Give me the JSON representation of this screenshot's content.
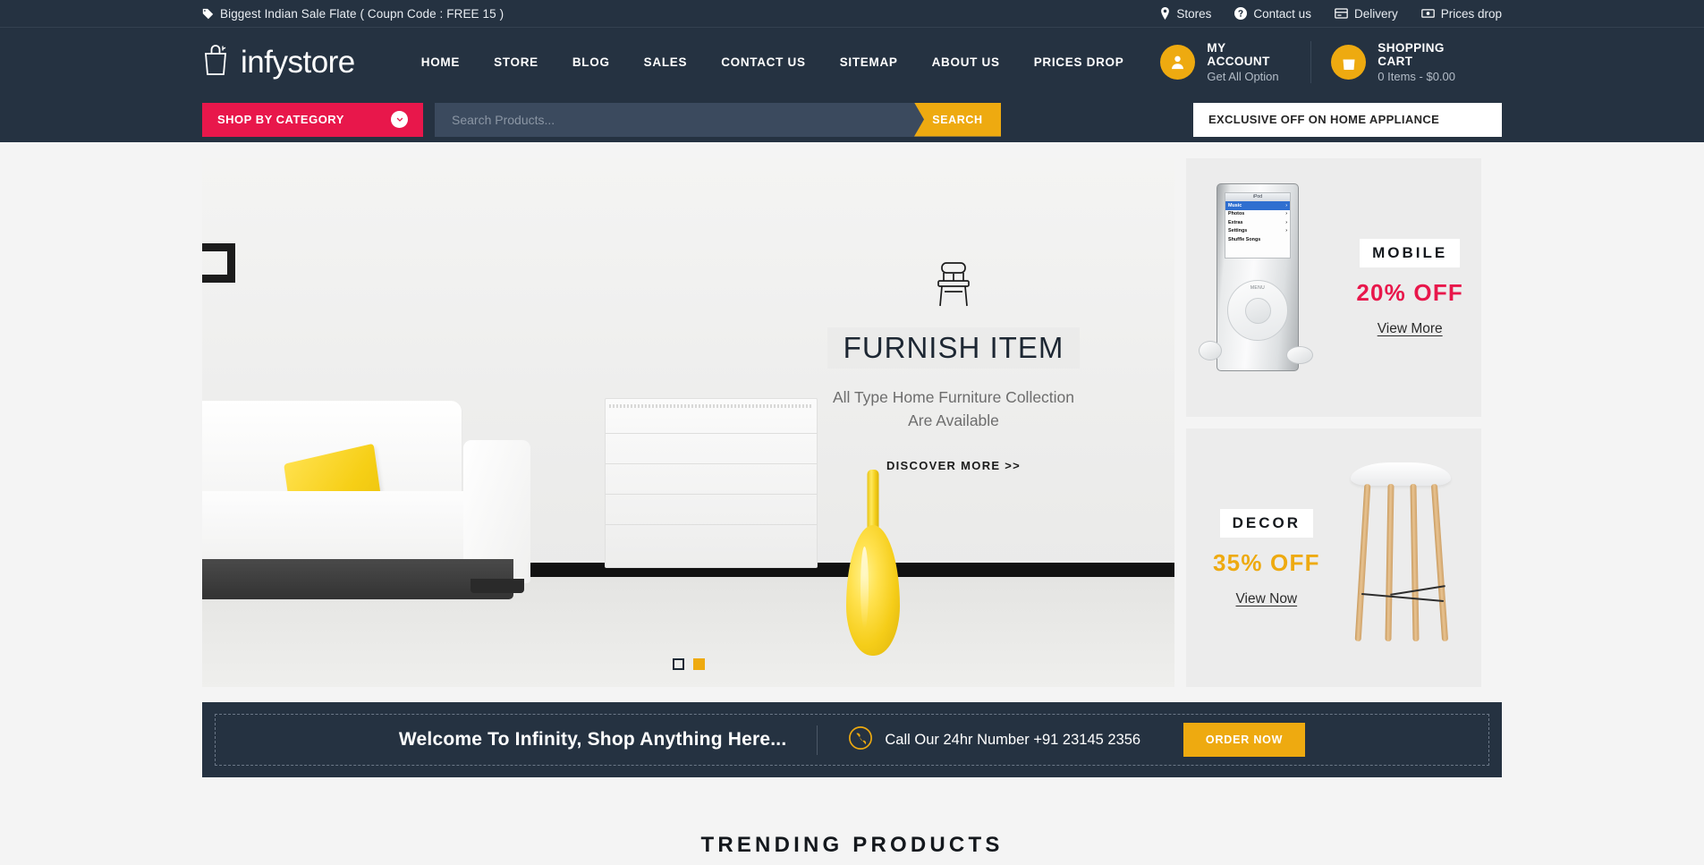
{
  "topbar": {
    "promo": "Biggest Indian Sale Flate ( Coupn Code : FREE 15 )",
    "promo_icon": "tag-icon",
    "links": [
      {
        "label": "Stores",
        "icon": "map-pin-icon"
      },
      {
        "label": "Contact us",
        "icon": "question-circle-icon"
      },
      {
        "label": "Delivery",
        "icon": "truck-card-icon"
      },
      {
        "label": "Prices drop",
        "icon": "price-tag-icon"
      }
    ]
  },
  "header": {
    "logo_text": "infystore",
    "logo_icon": "shopping-bag-icon",
    "nav": [
      {
        "label": "HOME"
      },
      {
        "label": "STORE"
      },
      {
        "label": "BLOG"
      },
      {
        "label": "SALES"
      },
      {
        "label": "CONTACT US"
      },
      {
        "label": "SITEMAP"
      },
      {
        "label": "ABOUT US"
      },
      {
        "label": "PRICES DROP"
      }
    ],
    "account": {
      "title": "MY ACCOUNT",
      "subtitle": "Get All Option",
      "icon": "user-icon"
    },
    "cart": {
      "title": "SHOPPING CART",
      "subtitle": "0 Items - $0.00",
      "icon": "shopping-bag-icon"
    }
  },
  "search": {
    "category_button": "SHOP BY CATEGORY",
    "category_icon": "chevron-down-icon",
    "placeholder": "Search Products...",
    "value": "",
    "button": "SEARCH",
    "exclusive_banner": "EXCLUSIVE OFF ON HOME APPLIANCE"
  },
  "slider": {
    "icon": "chair-icon",
    "title": "FURNISH ITEM",
    "subtitle_line1": "All Type Home Furniture Collection",
    "subtitle_line2": "Are Available",
    "cta": "DISCOVER MORE >>",
    "dots": [
      {
        "active": false
      },
      {
        "active": true
      }
    ]
  },
  "promos": [
    {
      "tag": "MOBILE",
      "discount": "20% OFF",
      "link": "View More",
      "color": "#e8174b",
      "image": "ipod-nano-with-earbuds"
    },
    {
      "tag": "DECOR",
      "discount": "35% OFF",
      "link": "View Now",
      "color": "#eeaa10",
      "image": "wooden-leg-bar-stool"
    }
  ],
  "cta_banner": {
    "welcome": "Welcome To Infinity, Shop Anything Here...",
    "phone_icon": "phone-icon",
    "phone": "Call Our 24hr Number +91 23145 2356",
    "button": "ORDER NOW"
  },
  "sections": {
    "trending_title": "TRENDING PRODUCTS"
  },
  "colors": {
    "header_bg": "#253241",
    "accent_amber": "#eeaa10",
    "accent_crimson": "#e8174b",
    "page_bg": "#f4f4f4"
  }
}
